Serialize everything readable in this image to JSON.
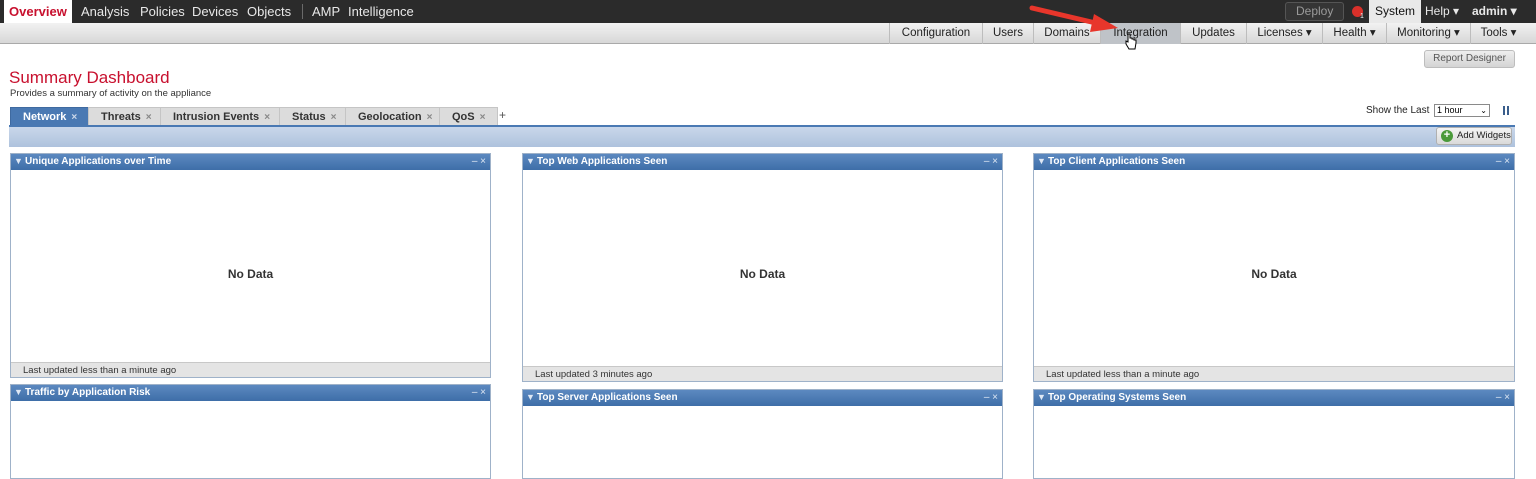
{
  "topnav": {
    "items": [
      "Overview",
      "Analysis",
      "Policies",
      "Devices",
      "Objects",
      "AMP",
      "Intelligence"
    ],
    "deploy": "Deploy",
    "alert_count": "1",
    "system": "System",
    "help": "Help ▾",
    "user": "admin ▾"
  },
  "subnav": {
    "items": [
      "Configuration",
      "Users",
      "Domains",
      "Integration",
      "Updates",
      "Licenses ▾",
      "Health ▾",
      "Monitoring ▾",
      "Tools ▾"
    ]
  },
  "page": {
    "report_designer": "Report Designer",
    "title": "Summary Dashboard",
    "subtitle": "Provides a summary of activity on the appliance"
  },
  "tabs": [
    "Network",
    "Threats",
    "Intrusion Events",
    "Status",
    "Geolocation",
    "QoS"
  ],
  "tab_close": "×",
  "tab_add": "+",
  "show_last": {
    "label": "Show the Last",
    "value": "1 hour"
  },
  "add_widgets": "Add Widgets",
  "widgets": [
    {
      "title": "Unique Applications over Time",
      "body": "No Data",
      "footer": "Last updated less than a minute ago"
    },
    {
      "title": "Top Web Applications Seen",
      "body": "No Data",
      "footer": "Last updated 3 minutes ago"
    },
    {
      "title": "Top Client Applications Seen",
      "body": "No Data",
      "footer": "Last updated less than a minute ago"
    },
    {
      "title": "Traffic by Application Risk"
    },
    {
      "title": "Top Server Applications Seen"
    },
    {
      "title": "Top Operating Systems Seen"
    }
  ],
  "widget_controls": "– ×",
  "colors": {
    "accent_red": "#c8102e",
    "widget_header": "#4a79b3",
    "topbar": "#2b2b2b"
  }
}
